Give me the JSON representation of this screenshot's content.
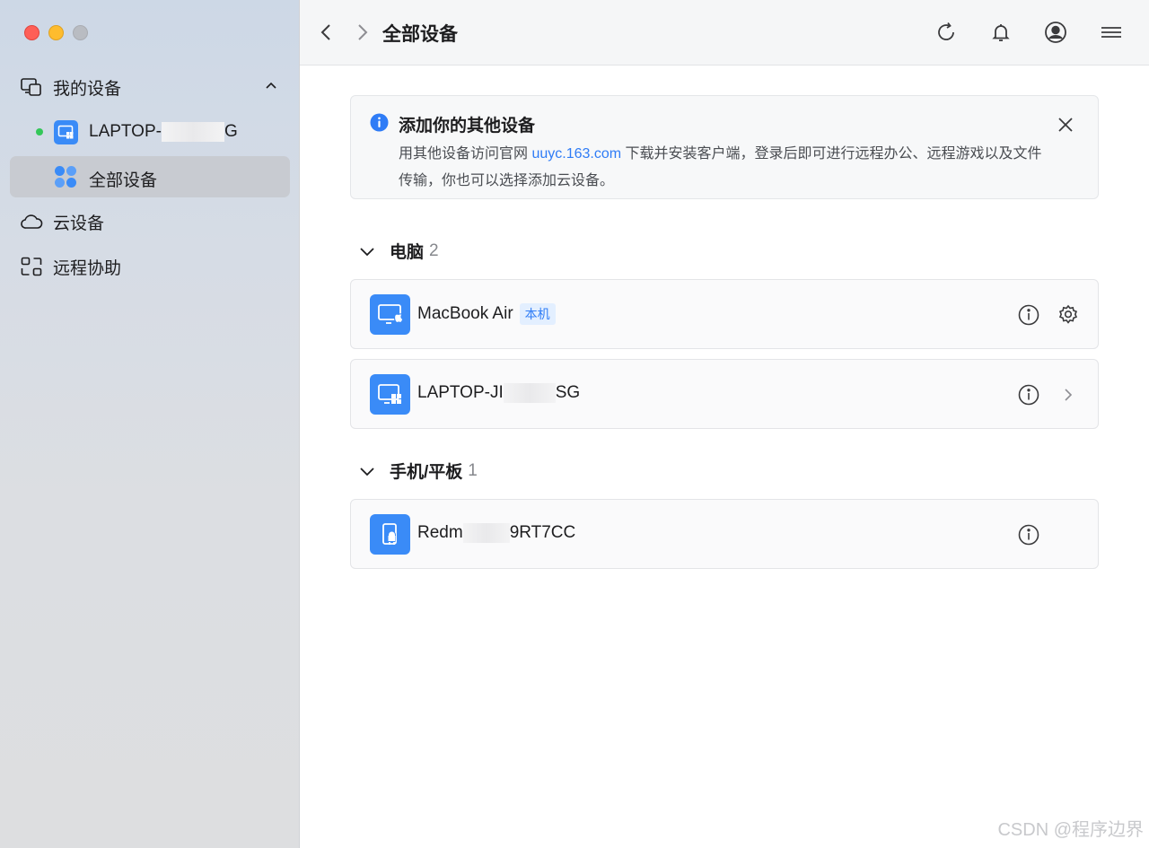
{
  "window": {
    "traffic_lights": [
      "close",
      "minimize",
      "zoom"
    ]
  },
  "sidebar": {
    "my_devices": {
      "label": "我的设备",
      "icon": "devices-icon",
      "expanded": true
    },
    "online_device": {
      "label_prefix": "LAPTOP-",
      "label_suffix": "G",
      "status_color": "#34c759"
    },
    "all_devices": {
      "label": "全部设备",
      "icon": "grid-dots-icon"
    },
    "cloud_devices": {
      "label": "云设备",
      "icon": "cloud-icon"
    },
    "remote_assist": {
      "label": "远程协助",
      "icon": "remote-assist-icon"
    }
  },
  "topbar": {
    "title": "全部设备",
    "icons": [
      "back-icon",
      "forward-icon",
      "refresh-icon",
      "bell-icon",
      "user-icon",
      "menu-icon"
    ]
  },
  "banner": {
    "title": "添加你的其他设备",
    "text_before_link": "用其他设备访问官网 ",
    "link": "uuyc.163.com",
    "text_after_link": " 下载并安装客户端，登录后即可进行远程办公、远程游戏以及文件传输，你也可以选择添加云设备。",
    "accent": "#2f7cf6"
  },
  "sections": {
    "computers": {
      "title": "电脑",
      "count": "2",
      "devices": [
        {
          "name": "MacBook Air",
          "tag": "本机",
          "icon": "mac-desktop-icon",
          "actions": [
            "info-icon",
            "settings-icon"
          ]
        },
        {
          "name_prefix": "LAPTOP-JI",
          "name_suffix": "SG",
          "icon": "windows-desktop-icon",
          "actions": [
            "info-icon",
            "chevron-right-icon"
          ]
        }
      ]
    },
    "mobiles": {
      "title": "手机/平板",
      "count": "1",
      "devices": [
        {
          "name_prefix": "Redm",
          "name_suffix": "9RT7CC",
          "icon": "android-phone-icon",
          "actions": [
            "info-icon"
          ]
        }
      ]
    }
  },
  "watermark": "CSDN @程序边界",
  "colors": {
    "device_icon_bg": "#3a8bf7",
    "sidebar_active": "#c8cbd1"
  }
}
